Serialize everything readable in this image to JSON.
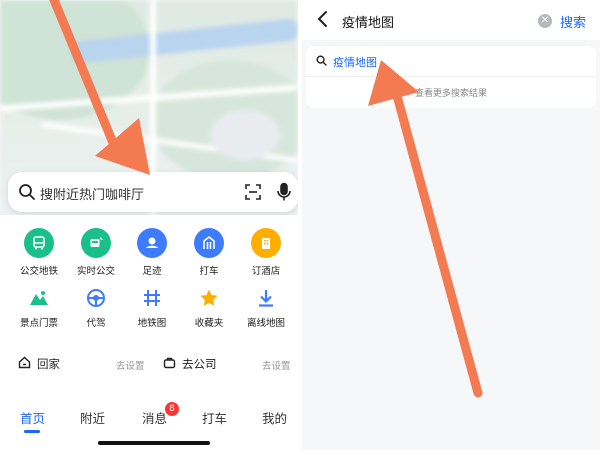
{
  "left": {
    "search_placeholder": "搜附近热门咖啡厅",
    "grid_row1": [
      {
        "label": "公交地铁",
        "icon": "bus-icon",
        "color": "#1bbf8a"
      },
      {
        "label": "实时公交",
        "icon": "realtime-bus-icon",
        "color": "#1bbf8a"
      },
      {
        "label": "足迹",
        "icon": "footprint-icon",
        "color": "#3d7cff"
      },
      {
        "label": "打车",
        "icon": "taxi-icon",
        "color": "#3d7cff"
      },
      {
        "label": "订酒店",
        "icon": "hotel-icon",
        "color": "#ffae00"
      }
    ],
    "grid_row2": [
      {
        "label": "景点门票",
        "icon": "scenic-icon",
        "color": "#1bbf8a"
      },
      {
        "label": "代驾",
        "icon": "steering-wheel-icon",
        "color": "#3d7cff"
      },
      {
        "label": "地铁图",
        "icon": "metro-map-icon",
        "color": "#3d7cff"
      },
      {
        "label": "收藏夹",
        "icon": "star-icon",
        "color": "#ffae00"
      },
      {
        "label": "离线地图",
        "icon": "download-icon",
        "color": "#3d7cff"
      }
    ],
    "favorites": {
      "home_label": "回家",
      "home_action": "去设置",
      "work_label": "去公司",
      "work_action": "去设置"
    },
    "tabs": {
      "home": "首页",
      "nearby": "附近",
      "messages": "消息",
      "messages_badge": "8",
      "taxi": "打车",
      "mine": "我的"
    }
  },
  "right": {
    "query": "疫情地图",
    "search_button": "搜索",
    "suggestion": "疫情地图",
    "more_results": "查看更多搜索结果"
  },
  "colors": {
    "accent": "#1a66ff",
    "arrow": "#f47a52",
    "badge": "#ff3333"
  }
}
